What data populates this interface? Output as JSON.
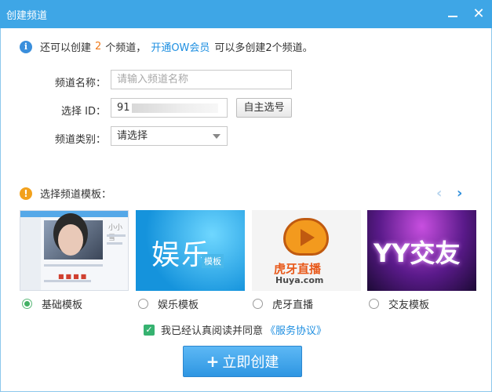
{
  "window": {
    "title": "创建频道"
  },
  "info": {
    "text1": "还可以创建",
    "count": "2",
    "text2": "个频道，",
    "link": "开通OW会员",
    "text3": "可以多创建2个频道。"
  },
  "form": {
    "name_label": "频道名称：",
    "name_placeholder": "请输入频道名称",
    "id_label": "选择 ID：",
    "id_value": "91",
    "id_button": "自主选号",
    "category_label": "频道类别：",
    "category_value": "请选择"
  },
  "templates": {
    "heading": "选择频道模板：",
    "items": [
      {
        "label": "基础模板",
        "selected": true,
        "thumb_text": "小小雪"
      },
      {
        "label": "娱乐模板",
        "selected": false,
        "thumb_text": "娱乐",
        "thumb_sub": "模板"
      },
      {
        "label": "虎牙直播",
        "selected": false,
        "thumb_text": "虎牙直播",
        "thumb_sub": "Huya.com"
      },
      {
        "label": "交友模板",
        "selected": false,
        "thumb_text": "YY交友"
      }
    ]
  },
  "agreement": {
    "text": "我已经认真阅读并同意",
    "link": "《服务协议》",
    "checked": true
  },
  "submit": {
    "label": "立即创建"
  },
  "colors": {
    "titlebar": "#3ea6e6",
    "accent_orange": "#f07a1a",
    "link_blue": "#1e8fe1",
    "check_green": "#36b270"
  }
}
